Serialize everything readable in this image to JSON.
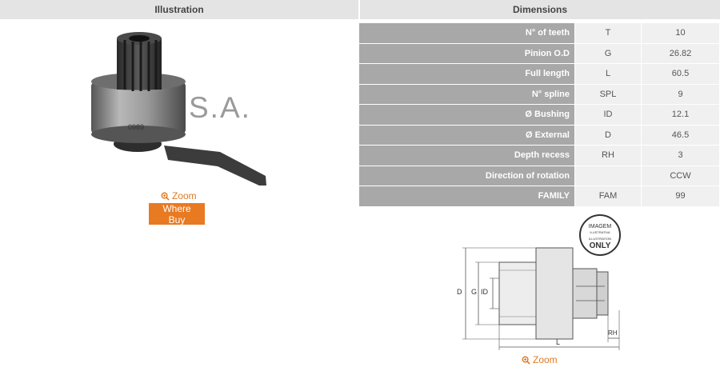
{
  "headers": {
    "illustration": "Illustration",
    "dimensions": "Dimensions"
  },
  "watermark": "S.A.",
  "photo_stamp": "0989",
  "left_zoom": "Zoom",
  "where_buy": "Where Buy",
  "right_zoom": "Zoom",
  "dimensions": [
    {
      "label": "N° of teeth",
      "symbol": "T",
      "value": "10"
    },
    {
      "label": "Pinion O.D",
      "symbol": "G",
      "value": "26.82"
    },
    {
      "label": "Full length",
      "symbol": "L",
      "value": "60.5"
    },
    {
      "label": "N° spline",
      "symbol": "SPL",
      "value": "9"
    },
    {
      "label": "Ø Bushing",
      "symbol": "ID",
      "value": "12.1"
    },
    {
      "label": "Ø External",
      "symbol": "D",
      "value": "46.5"
    },
    {
      "label": "Depth recess",
      "symbol": "RH",
      "value": "3"
    },
    {
      "label": "Direction of rotation",
      "symbol": "",
      "value": "CCW"
    },
    {
      "label": "FAMILY",
      "symbol": "FAM",
      "value": "99"
    }
  ],
  "diagram": {
    "badge_top": "IMAGEM",
    "badge_mid": "ILUSTRATIVA",
    "badge_en": "ILLUSTRATION",
    "badge_only": "ONLY",
    "label_d": "D",
    "label_g": "G",
    "label_id": "ID",
    "label_l": "L",
    "label_rh": "RH"
  },
  "colors": {
    "header_bg": "#e4e4e4",
    "label_bg": "#a8a8a8",
    "value_bg": "#f0f0f0",
    "accent": "#e87a22"
  }
}
